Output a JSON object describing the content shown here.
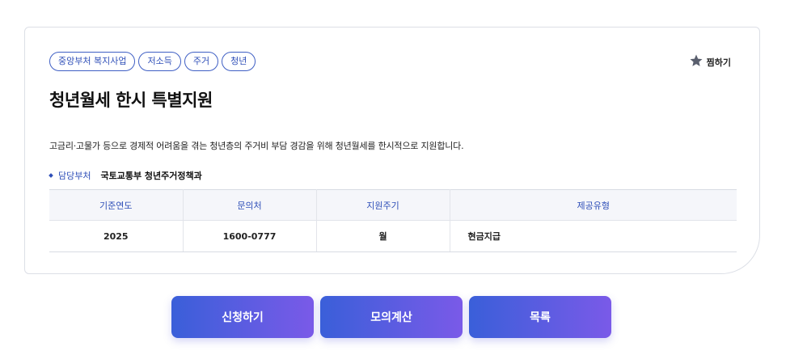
{
  "tags": [
    "중앙부처 복지사업",
    "저소득",
    "주거",
    "청년"
  ],
  "favorite": {
    "label": "찜하기",
    "icon": "star-icon"
  },
  "title": "청년월세 한시 특별지원",
  "description": "고금리·고물가 등으로 경제적 어려움을 겪는 청년층의 주거비 부담 경감을 위해 청년월세를 한시적으로 지원합니다.",
  "department": {
    "label": "담당부처",
    "value": "국토교통부 청년주거정책과"
  },
  "table": {
    "headers": [
      "기준연도",
      "문의처",
      "지원주기",
      "제공유형"
    ],
    "row": [
      "2025",
      "1600-0777",
      "월",
      "현금지급"
    ]
  },
  "buttons": {
    "apply": "신청하기",
    "simulate": "모의계산",
    "list": "목록"
  },
  "colors": {
    "accent": "#2f4fb8",
    "button_start": "#3a5fd9",
    "button_end": "#7a5ae8",
    "star": "#5a5f6e"
  }
}
